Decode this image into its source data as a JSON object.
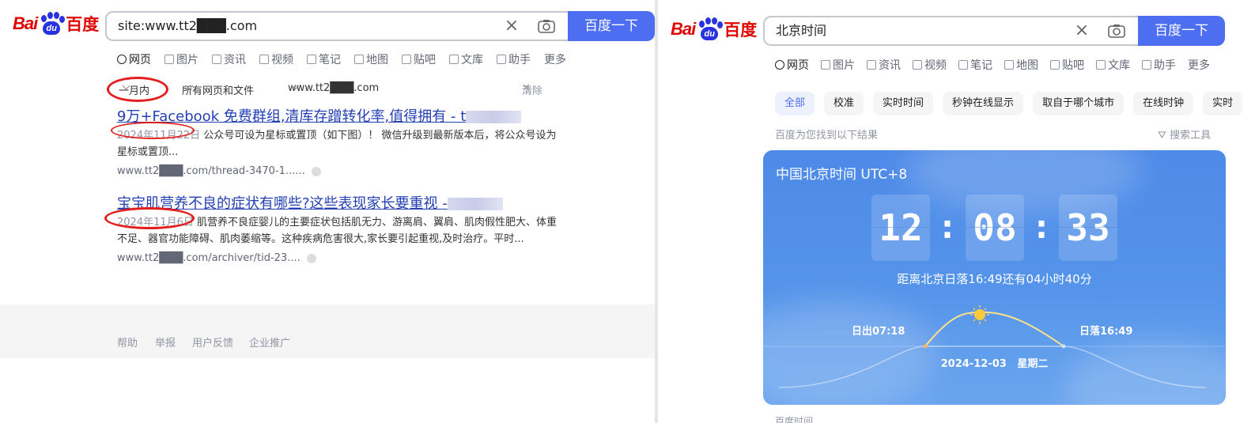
{
  "left": {
    "logo": {
      "bai": "Bai",
      "du": "du",
      "baidu_cn": "百度"
    },
    "search": {
      "query": "site:www.tt2███.com",
      "button": "百度一下"
    },
    "tabs": [
      "网页",
      "图片",
      "资讯",
      "视频",
      "笔记",
      "地图",
      "贴吧",
      "文库",
      "助手",
      "更多"
    ],
    "filters": {
      "time": "一月内",
      "type": "所有网页和文件",
      "site": "www.tt2███.com",
      "clear": "清除"
    },
    "results": [
      {
        "title": "9万+Facebook 免费群组,清库存蹭转化率,值得拥有 - t",
        "date": "2024年11月22日",
        "abstract": "公众号可设为星标或置顶（如下图）！ 微信升级到最新版本后，将公众号设为星标或置顶...",
        "url": "www.tt2███.com/thread-3470-1......"
      },
      {
        "title": "宝宝肌营养不良的症状有哪些?这些表现家长要重视 -",
        "date": "2024年11月6日",
        "abstract": "肌营养不良症婴儿的主要症状包括肌无力、游离肩、翼肩、肌肉假性肥大、体重不足、器官功能障碍、肌肉萎缩等。这种疾病危害很大,家长要引起重视,及时治疗。平时...",
        "url": "www.tt2███.com/archiver/tid-23...."
      }
    ],
    "footer": [
      "帮助",
      "举报",
      "用户反馈",
      "企业推广"
    ]
  },
  "right": {
    "logo": {
      "bai": "Bai",
      "du": "du",
      "baidu_cn": "百度"
    },
    "search": {
      "query": "北京时间",
      "button": "百度一下"
    },
    "tabs": [
      "网页",
      "图片",
      "资讯",
      "视频",
      "笔记",
      "地图",
      "贴吧",
      "文库",
      "助手",
      "更多"
    ],
    "chips": [
      "全部",
      "校准",
      "实时时间",
      "秒钟在线显示",
      "取自于哪个城市",
      "在线时钟",
      "实时"
    ],
    "found": "百度为您找到以下结果",
    "tools": "搜索工具",
    "card": {
      "title": "中国北京时间 UTC+8",
      "hour": "12",
      "minute": "08",
      "second": "33",
      "sunset_note": "距离北京日落16:49还有04小时40分",
      "sunrise": "日出07:18",
      "sunset": "日落16:49",
      "date": "2024-12-03",
      "weekday": "星期二"
    },
    "below": "百度时间"
  },
  "colors": {
    "brand_blue": "#4e6ef2",
    "link": "#2440b3",
    "annotation_red": "#e41e1e"
  }
}
